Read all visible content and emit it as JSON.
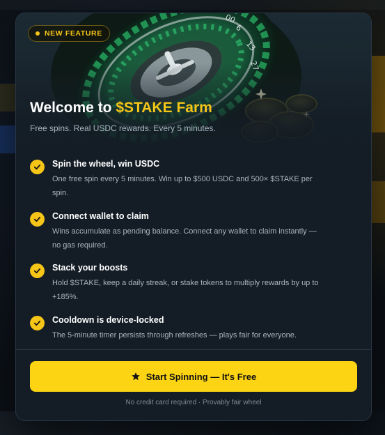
{
  "badge": {
    "label": "NEW FEATURE"
  },
  "header": {
    "title_prefix": "Welcome to ",
    "title_accent": "$STAKE Farm",
    "subtitle": "Free spins. Real USDC rewards. Every 5 minutes."
  },
  "features": [
    {
      "title": "Spin the wheel, win USDC",
      "desc_line1": "One free spin every 5 minutes. Win up to $500 USDC and 500× $STAKE per",
      "desc_line2": "spin."
    },
    {
      "title": "Connect wallet to claim",
      "desc_line1": "Wins accumulate as pending balance. Connect any wallet to claim instantly —",
      "desc_line2": "no gas required."
    },
    {
      "title": "Stack your boosts",
      "desc_line1": "Hold $STAKE, keep a daily streak, or stake tokens to multiply rewards by up to",
      "desc_line2": "+185%."
    },
    {
      "title": "Cooldown is device-locked",
      "desc_line1": "The 5-minute timer persists through refreshes — plays fair for everyone."
    }
  ],
  "cta": {
    "label": "Start Spinning — It's Free",
    "icon": "star-icon"
  },
  "footnote": "No credit card required · Provably fair wheel",
  "roulette_numbers": [
    "6",
    "13",
    "27",
    "00"
  ],
  "colors": {
    "accent": "#f5c518",
    "button": "#fcd414",
    "panel": "#141d26",
    "roulette_green": "#1f8a4c"
  }
}
